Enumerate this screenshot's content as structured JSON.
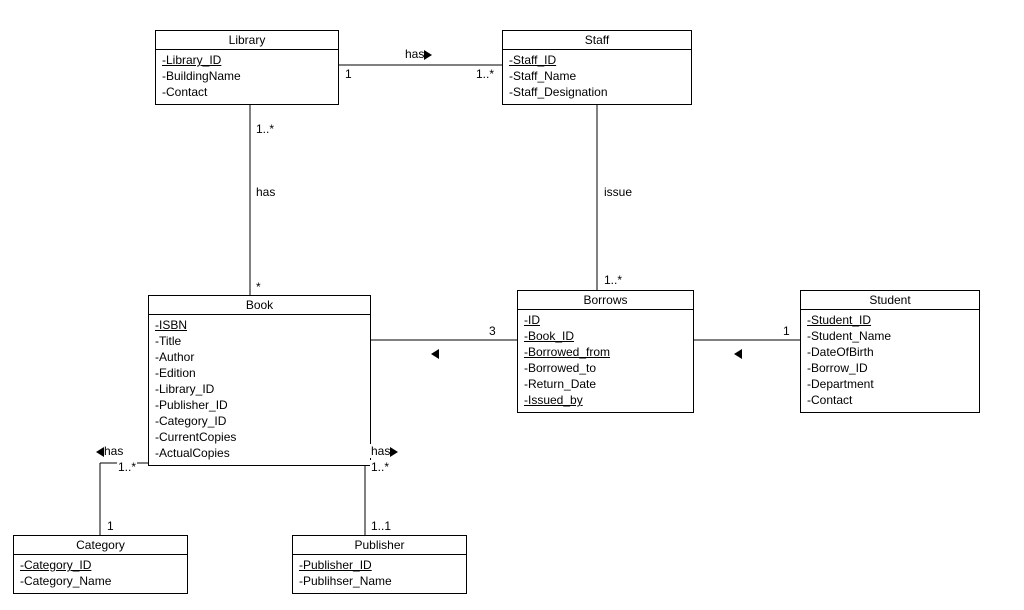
{
  "classes": {
    "library": {
      "title": "Library",
      "attrs": [
        "-Library_ID",
        "-BuildingName",
        "-Contact"
      ],
      "underline": [
        0
      ]
    },
    "staff": {
      "title": "Staff",
      "attrs": [
        "-Staff_ID",
        "-Staff_Name",
        "-Staff_Designation"
      ],
      "underline": [
        0
      ]
    },
    "book": {
      "title": "Book",
      "attrs": [
        "-ISBN",
        "-Title",
        "-Author",
        "-Edition",
        "-Library_ID",
        "-Publisher_ID",
        "-Category_ID",
        "-CurrentCopies",
        "-ActualCopies"
      ],
      "underline": [
        0
      ]
    },
    "borrows": {
      "title": "Borrows",
      "attrs": [
        "-ID",
        "-Book_ID",
        "-Borrowed_from",
        "-Borrowed_to",
        "-Return_Date",
        "-Issued_by"
      ],
      "underline": [
        0,
        1,
        2,
        5
      ]
    },
    "student": {
      "title": "Student",
      "attrs": [
        "-Student_ID",
        "-Student_Name",
        "-DateOfBirth",
        "-Borrow_ID",
        "-Department",
        "-Contact"
      ],
      "underline": [
        0
      ]
    },
    "category": {
      "title": "Category",
      "attrs": [
        "-Category_ID",
        "-Category_Name"
      ],
      "underline": [
        0
      ]
    },
    "publisher": {
      "title": "Publisher",
      "attrs": [
        "-Publisher_ID",
        "-Publihser_Name"
      ],
      "underline": [
        0
      ]
    }
  },
  "associations": {
    "library_staff": {
      "label": "has",
      "dir": "right",
      "m1": "1",
      "m2": "1..*"
    },
    "library_book": {
      "label": "has",
      "m1": "1..*",
      "m2": "*"
    },
    "staff_borrows": {
      "label": "issue",
      "m2": "1..*"
    },
    "book_borrows": {
      "dir": "left",
      "m1": "3"
    },
    "borrows_student": {
      "dir": "left",
      "m2": "1"
    },
    "book_category": {
      "label": "has",
      "dir": "left",
      "m1": "1..*",
      "m2": "1"
    },
    "book_publisher": {
      "label": "has",
      "dir": "right",
      "m1": "1..*",
      "m2": "1..1"
    }
  },
  "chart_data": {
    "type": "uml-class-diagram",
    "classes": [
      {
        "name": "Library",
        "attributes": [
          "Library_ID",
          "BuildingName",
          "Contact"
        ],
        "keys": [
          "Library_ID"
        ]
      },
      {
        "name": "Staff",
        "attributes": [
          "Staff_ID",
          "Staff_Name",
          "Staff_Designation"
        ],
        "keys": [
          "Staff_ID"
        ]
      },
      {
        "name": "Book",
        "attributes": [
          "ISBN",
          "Title",
          "Author",
          "Edition",
          "Library_ID",
          "Publisher_ID",
          "Category_ID",
          "CurrentCopies",
          "ActualCopies"
        ],
        "keys": [
          "ISBN"
        ]
      },
      {
        "name": "Borrows",
        "attributes": [
          "ID",
          "Book_ID",
          "Borrowed_from",
          "Borrowed_to",
          "Return_Date",
          "Issued_by"
        ],
        "keys": [
          "ID",
          "Book_ID",
          "Borrowed_from",
          "Issued_by"
        ]
      },
      {
        "name": "Student",
        "attributes": [
          "Student_ID",
          "Student_Name",
          "DateOfBirth",
          "Borrow_ID",
          "Department",
          "Contact"
        ],
        "keys": [
          "Student_ID"
        ]
      },
      {
        "name": "Category",
        "attributes": [
          "Category_ID",
          "Category_Name"
        ],
        "keys": [
          "Category_ID"
        ]
      },
      {
        "name": "Publisher",
        "attributes": [
          "Publisher_ID",
          "Publihser_Name"
        ],
        "keys": [
          "Publisher_ID"
        ]
      }
    ],
    "associations": [
      {
        "from": "Library",
        "to": "Staff",
        "name": "has",
        "from_mult": "1",
        "to_mult": "1..*",
        "nav": "to"
      },
      {
        "from": "Library",
        "to": "Book",
        "name": "has",
        "from_mult": "1..*",
        "to_mult": "*"
      },
      {
        "from": "Staff",
        "to": "Borrows",
        "name": "issue",
        "to_mult": "1..*"
      },
      {
        "from": "Borrows",
        "to": "Book",
        "from_mult": "",
        "to_mult": "3",
        "nav": "to"
      },
      {
        "from": "Student",
        "to": "Borrows",
        "from_mult": "1",
        "nav": "to"
      },
      {
        "from": "Book",
        "to": "Category",
        "name": "has",
        "from_mult": "1..*",
        "to_mult": "1",
        "nav": "to"
      },
      {
        "from": "Book",
        "to": "Publisher",
        "name": "has",
        "from_mult": "1..*",
        "to_mult": "1..1",
        "nav": "to"
      }
    ]
  }
}
